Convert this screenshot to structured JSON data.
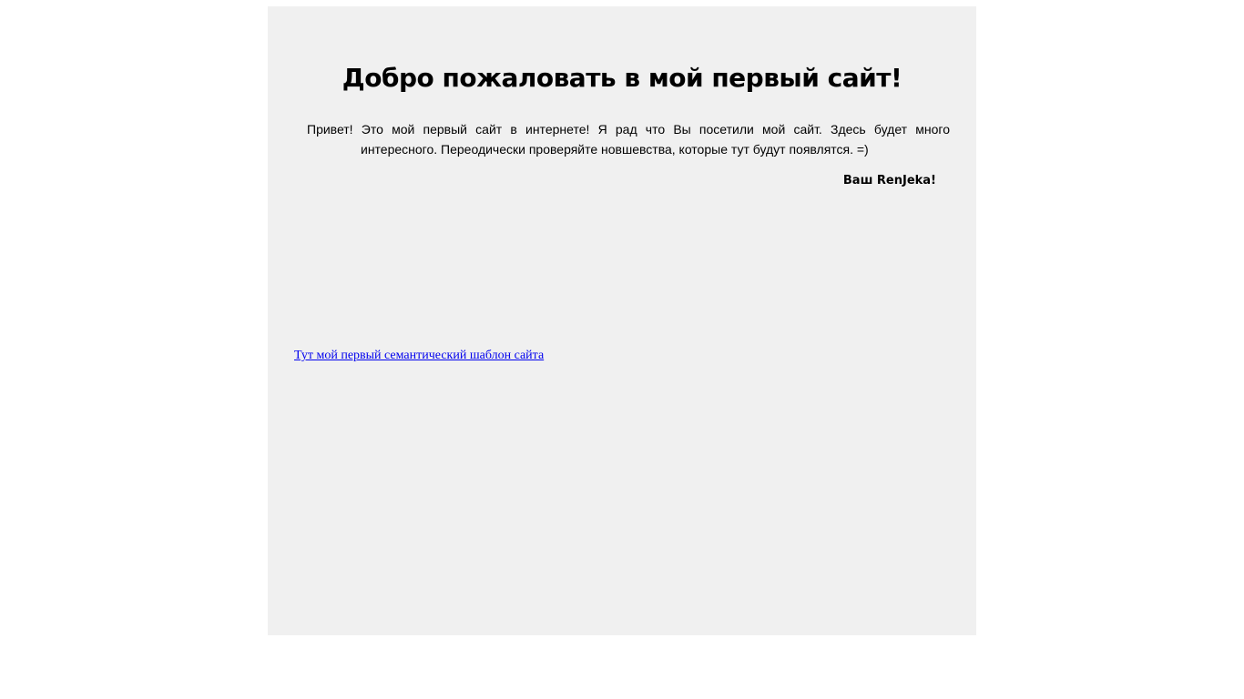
{
  "page": {
    "title": "Добро пожаловать в мой первый сайт!",
    "intro_text": "Привет! Это мой первый сайт в интернете! Я рад что Вы посетили мой сайт. Здесь будет много интересного. Переодически проверяйте новшевства, которые тут будут появлятся. =)",
    "signature": "Ваш RenJeka!",
    "template_link_label": "Тут мой первый семантический шаблон сайта"
  },
  "colors": {
    "page_background": "#ffffff",
    "content_background": "#f0f0f0",
    "text": "#000000",
    "link": "#0000ee"
  }
}
